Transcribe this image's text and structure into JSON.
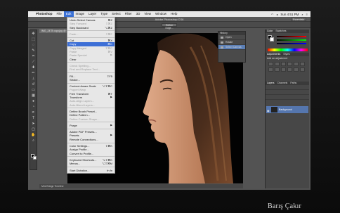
{
  "menubar": {
    "app": "Photoshop",
    "items": [
      {
        "label": "File",
        "active": false
      },
      {
        "label": "Edit",
        "active": true
      },
      {
        "label": "Image",
        "active": false
      },
      {
        "label": "Layer",
        "active": false
      },
      {
        "label": "Type",
        "active": false
      },
      {
        "label": "Select",
        "active": false
      },
      {
        "label": "Filter",
        "active": false
      },
      {
        "label": "3D",
        "active": false
      },
      {
        "label": "View",
        "active": false
      },
      {
        "label": "Window",
        "active": false
      },
      {
        "label": "Help",
        "active": false
      }
    ],
    "clock": "Sun 4:51 PM"
  },
  "appbar": {
    "title": "Adobe Photoshop CS6",
    "workspace": "Essentials",
    "refine_edge": "Refine Edge..."
  },
  "document": {
    "tab": "IMG_2478 copy.jpg @ 66.7% (Layer 0, RGB/8)",
    "status": "Mini Bridge   Timeline"
  },
  "edit_menu": {
    "items": [
      {
        "label": "Undo Select Canvas",
        "shortcut": "⌘Z",
        "disabled": false
      },
      {
        "label": "Step Forward",
        "shortcut": "⇧⌘Z",
        "disabled": true
      },
      {
        "label": "Step Backward",
        "shortcut": "⌥⌘Z",
        "disabled": false
      },
      {
        "sep": true
      },
      {
        "label": "Fade...",
        "shortcut": "⇧⌘F",
        "disabled": true
      },
      {
        "sep": true
      },
      {
        "label": "Cut",
        "shortcut": "⌘X",
        "disabled": false
      },
      {
        "label": "Copy",
        "shortcut": "⌘C",
        "disabled": false,
        "highlighted": true
      },
      {
        "label": "Copy Merged",
        "shortcut": "⇧⌘C",
        "disabled": true
      },
      {
        "label": "Paste",
        "shortcut": "⌘V",
        "disabled": true
      },
      {
        "label": "Paste Special",
        "submenu": true,
        "disabled": true
      },
      {
        "label": "Clear",
        "disabled": false
      },
      {
        "sep": true
      },
      {
        "label": "Check Spelling...",
        "disabled": true
      },
      {
        "label": "Find and Replace Text...",
        "disabled": true
      },
      {
        "sep": true
      },
      {
        "label": "Fill...",
        "shortcut": "⇧F5",
        "disabled": false
      },
      {
        "label": "Stroke...",
        "disabled": false
      },
      {
        "sep": true
      },
      {
        "label": "Content-Aware Scale",
        "shortcut": "⌥⇧⌘C",
        "disabled": false
      },
      {
        "label": "Puppet Warp",
        "disabled": true
      },
      {
        "label": "Free Transform",
        "shortcut": "⌘T",
        "disabled": false
      },
      {
        "label": "Transform",
        "submenu": true,
        "disabled": false
      },
      {
        "label": "Auto-Align Layers...",
        "disabled": true
      },
      {
        "label": "Auto-Blend Layers...",
        "disabled": true
      },
      {
        "sep": true
      },
      {
        "label": "Define Brush Preset...",
        "disabled": false
      },
      {
        "label": "Define Pattern...",
        "disabled": false
      },
      {
        "label": "Define Custom Shape...",
        "disabled": true
      },
      {
        "sep": true
      },
      {
        "label": "Purge",
        "submenu": true,
        "disabled": false
      },
      {
        "sep": true
      },
      {
        "label": "Adobe PDF Presets...",
        "disabled": false
      },
      {
        "label": "Presets",
        "submenu": true,
        "disabled": false
      },
      {
        "label": "Remote Connections...",
        "disabled": false
      },
      {
        "sep": true
      },
      {
        "label": "Color Settings...",
        "shortcut": "⇧⌘K",
        "disabled": false
      },
      {
        "label": "Assign Profile...",
        "disabled": false
      },
      {
        "label": "Convert to Profile...",
        "disabled": false
      },
      {
        "sep": true
      },
      {
        "label": "Keyboard Shortcuts...",
        "shortcut": "⌥⇧⌘K",
        "disabled": false
      },
      {
        "label": "Menus...",
        "shortcut": "⌥⇧⌘M",
        "disabled": false
      },
      {
        "sep": true
      },
      {
        "label": "Start Dictation...",
        "shortcut": "fn fn",
        "disabled": false
      }
    ]
  },
  "mini_panel": {
    "header": "History",
    "rows": [
      "Open",
      "Rotate",
      "Select Canvas"
    ]
  },
  "panels": {
    "color_tabs": [
      "Color",
      "Swatches"
    ],
    "adjust_tabs": [
      "Adjustments",
      "Styles"
    ],
    "adjust_hint": "Add an adjustment",
    "layer_tabs": [
      "Layers",
      "Channels",
      "Paths"
    ],
    "layer_name": "Background"
  },
  "signature": "Barış Çakır"
}
